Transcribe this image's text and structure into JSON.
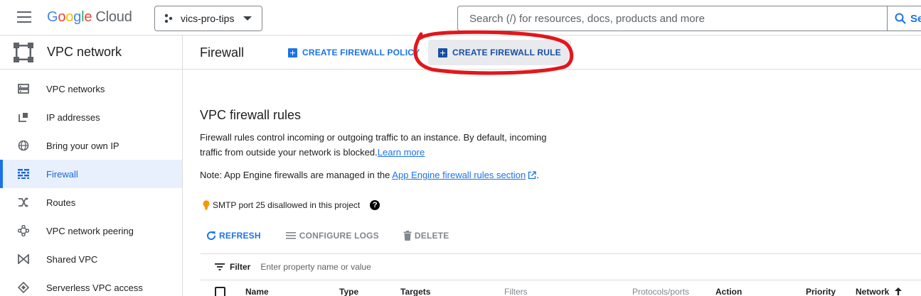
{
  "topbar": {
    "logo_google": [
      "G",
      "o",
      "o",
      "g",
      "l",
      "e"
    ],
    "logo_cloud": "Cloud",
    "project_name": "vics-pro-tips",
    "search_placeholder": "Search (/) for resources, docs, products and more",
    "search_button": "Se"
  },
  "sidebar": {
    "title": "VPC network",
    "items": [
      {
        "label": "VPC networks",
        "icon": "vpc-networks-icon"
      },
      {
        "label": "IP addresses",
        "icon": "ip-addresses-icon"
      },
      {
        "label": "Bring your own IP",
        "icon": "globe-icon"
      },
      {
        "label": "Firewall",
        "icon": "firewall-icon",
        "active": true
      },
      {
        "label": "Routes",
        "icon": "routes-icon"
      },
      {
        "label": "VPC network peering",
        "icon": "peering-icon"
      },
      {
        "label": "Shared VPC",
        "icon": "shared-vpc-icon"
      },
      {
        "label": "Serverless VPC access",
        "icon": "serverless-icon"
      }
    ]
  },
  "header": {
    "title": "Firewall",
    "create_policy": "CREATE FIREWALL POLICY",
    "create_rule": "CREATE FIREWALL RULE"
  },
  "main": {
    "section_title": "VPC firewall rules",
    "desc_line1": "Firewall rules control incoming or outgoing traffic to an instance. By default, incoming",
    "desc_line2": "traffic from outside your network is blocked.",
    "learn_more": "Learn more",
    "note_prefix": "Note: App Engine firewalls are managed in the ",
    "note_link": "App Engine firewall rules section",
    "note_suffix": ".",
    "smtp_text": "SMTP port 25 disallowed in this project",
    "help_glyph": "?"
  },
  "actions": {
    "refresh": "REFRESH",
    "configure_logs": "CONFIGURE LOGS",
    "delete": "DELETE"
  },
  "filter": {
    "label": "Filter",
    "placeholder": "Enter property name or value"
  },
  "table": {
    "columns": [
      "Name",
      "Type",
      "Targets",
      "Filters",
      "Protocols/ports",
      "Action",
      "Priority",
      "Network"
    ]
  },
  "colors": {
    "accent": "#1a73e8",
    "active_bg": "#e8f0fe",
    "annotation": "#e3161b"
  }
}
